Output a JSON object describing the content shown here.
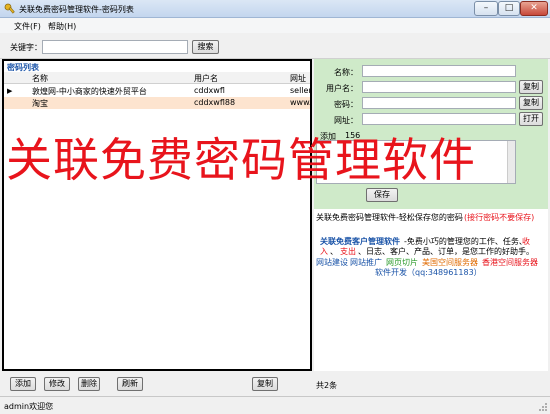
{
  "window": {
    "title": "关联免费密码管理软件-密码列表",
    "min_label": "–",
    "max_label": "□",
    "close_label": "✕"
  },
  "menu": {
    "file": "文件(F)",
    "help": "帮助(H)"
  },
  "search": {
    "label": "关键字：",
    "value": "",
    "button": "搜索"
  },
  "list": {
    "title": "密码列表",
    "columns": [
      "名称",
      "用户名",
      "网址"
    ],
    "rows": [
      {
        "name": "敦煌网-中小商家的快速外贸平台",
        "user": "cddxwfl",
        "url": "seller.",
        "selected": false,
        "current": true
      },
      {
        "name": "淘宝",
        "user": "cddxwfl88",
        "url": "www.t",
        "selected": true,
        "current": false
      }
    ]
  },
  "detail": {
    "name_label": "名称：",
    "user_label": "用户名：",
    "password_label": "密码：",
    "url_label": "网址：",
    "note_label": "添加",
    "note_partial": "156",
    "copy_button": "复制",
    "open_button": "打开",
    "save_button": "保存"
  },
  "info": {
    "tagline": "关联免费密码管理软件-轻松保存您的密码",
    "tagline_link": "(接行密码不要保存)",
    "promo_title": "关联免费客户管理软件",
    "promo_line1_rest": "-免费小巧的管理您的工作、任务、",
    "promo_income": "收",
    "promo_line2_a": "入",
    "promo_line2_b": "、",
    "promo_expense": "支出",
    "promo_line2_rest": "、日志、客户、产品、订单，是您工作的好助手。",
    "links": [
      "网站建设",
      "网站推广",
      "网页切片",
      "美国空间服务器",
      "香港空间服务器"
    ],
    "dev": "软件开发（qq:348961183）"
  },
  "bottom": {
    "add": "添加",
    "edit": "修改",
    "delete": "删除",
    "refresh": "刷新",
    "copy": "复制",
    "count": "共2条"
  },
  "status": {
    "text": "admin欢迎您"
  },
  "watermark": {
    "text": "关联免费密码管理软件"
  },
  "colors": {
    "title_link": "#1b54a8",
    "promo_red": "#e8141c",
    "link_blue": "#1b54a8",
    "link_green": "#2a9a2a",
    "link_orange": "#e06a00"
  }
}
